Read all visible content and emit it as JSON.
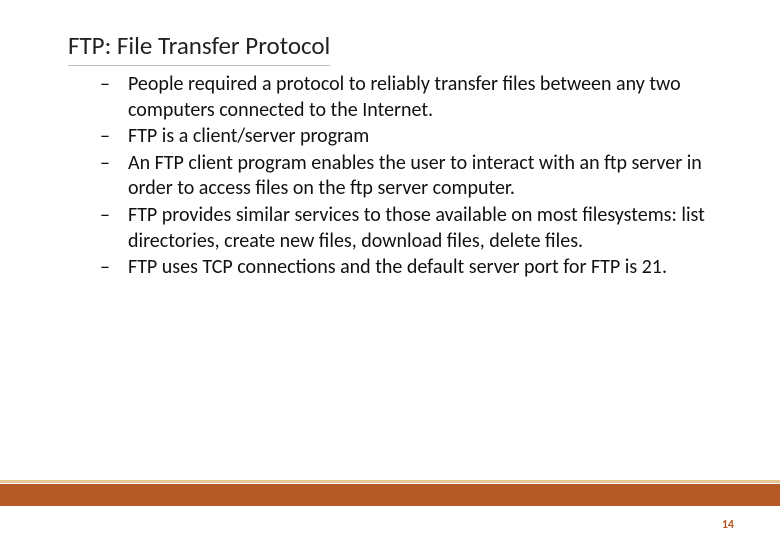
{
  "title": "FTP: File Transfer Protocol",
  "bullets": [
    "People required a protocol to reliably transfer files between any two computers connected to the Internet.",
    "FTP is a client/server program",
    "An FTP client program enables the user to interact with an ftp server in order to access files on the ftp server computer.",
    "FTP provides similar services to those available on most filesystems: list directories, create new files, download files, delete files.",
    "FTP uses TCP connections and the default server port for FTP is 21."
  ],
  "page_number": "14",
  "colors": {
    "accent": "#b55a27",
    "accent_light": "#e6c89a"
  }
}
